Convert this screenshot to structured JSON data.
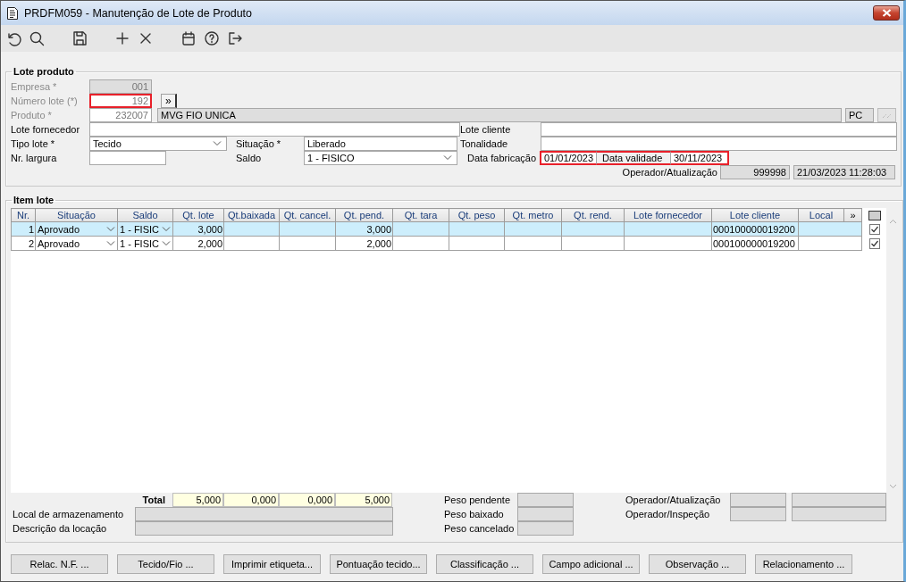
{
  "window": {
    "title": "PRDFM059 - Manutenção de Lote de Produto"
  },
  "toolbar": [
    [
      {
        "kind": "undo"
      },
      {
        "kind": "search"
      }
    ],
    [
      {
        "kind": "save"
      }
    ],
    [
      {
        "kind": "add"
      },
      {
        "kind": "delete"
      }
    ],
    [
      {
        "kind": "calendar"
      },
      {
        "kind": "help"
      },
      {
        "kind": "exit"
      }
    ]
  ],
  "lote_produto": {
    "title": "Lote produto",
    "empresa": {
      "label": "Empresa *",
      "value": "001",
      "disabled": true
    },
    "numero_lote": {
      "label": "Número lote (*)",
      "value": "192",
      "disabled": true,
      "highlighted": true,
      "button": "»"
    },
    "produto": {
      "label": "Produto *",
      "value": "232007",
      "description": "MVG FIO UNICA",
      "unit": "PC",
      "disabled": true
    },
    "lote_fornecedor": {
      "label": "Lote fornecedor"
    },
    "lote_cliente": {
      "label": "Lote cliente"
    },
    "tipo_lote": {
      "label": "Tipo lote *",
      "value": "Tecido"
    },
    "situacao": {
      "label": "Situação *",
      "value": "Liberado"
    },
    "tonalidade": {
      "label": "Tonalidade"
    },
    "nr_largura": {
      "label": "Nr. largura"
    },
    "saldo": {
      "label": "Saldo",
      "value": "1 - FISICO"
    },
    "data_fabricacao": {
      "label": "Data fabricação",
      "value": "01/01/2023",
      "highlighted": true
    },
    "data_validade": {
      "label": "Data validade",
      "value": "30/11/2023",
      "highlighted": true
    },
    "operador": {
      "label": "Operador/Atualização",
      "value": "999998",
      "timestamp": "21/03/2023 11:28:03"
    }
  },
  "item_lote": {
    "title": "Item lote",
    "columns": [
      "Nr.",
      "Situação",
      "Saldo",
      "Qt. lote",
      "Qt.baixada",
      "Qt. cancel.",
      "Qt. pend.",
      "Qt. tara",
      "Qt. peso",
      "Qt. metro",
      "Qt. rend.",
      "Lote fornecedor",
      "Lote cliente",
      "Local"
    ],
    "more_button": "»",
    "select_all": {
      "indeterminate": true
    },
    "rows": [
      {
        "nr": "1",
        "situacao": "Aprovado",
        "saldo": "1 - FISIC",
        "qt_lote": "3,000",
        "qt_pend": "3,000",
        "lote_cliente": "000100000019200",
        "selected": true,
        "checked": true
      },
      {
        "nr": "2",
        "situacao": "Aprovado",
        "saldo": "1 - FISIC",
        "qt_lote": "2,000",
        "qt_pend": "2,000",
        "lote_cliente": "000100000019200",
        "selected": false,
        "checked": true
      }
    ],
    "totals": {
      "label": "Total",
      "values": [
        "5,000",
        "0,000",
        "0,000",
        "5,000"
      ]
    },
    "local_fields": [
      {
        "label": "Local de armazenamento"
      },
      {
        "label": "Descrição da locação"
      }
    ],
    "pesos": [
      {
        "label": "Peso pendente"
      },
      {
        "label": "Peso baixado"
      },
      {
        "label": "Peso cancelado"
      }
    ],
    "operadores": [
      {
        "label": "Operador/Atualização"
      },
      {
        "label": "Operador/Inspeção"
      }
    ]
  },
  "buttons": [
    "Relac. N.F. ...",
    "Tecido/Fio ...",
    "Imprimir etiqueta...",
    "Pontuação tecido...",
    "Classificação ...",
    "Campo adicional ...",
    "Observação ...",
    "Relacionamento ..."
  ]
}
